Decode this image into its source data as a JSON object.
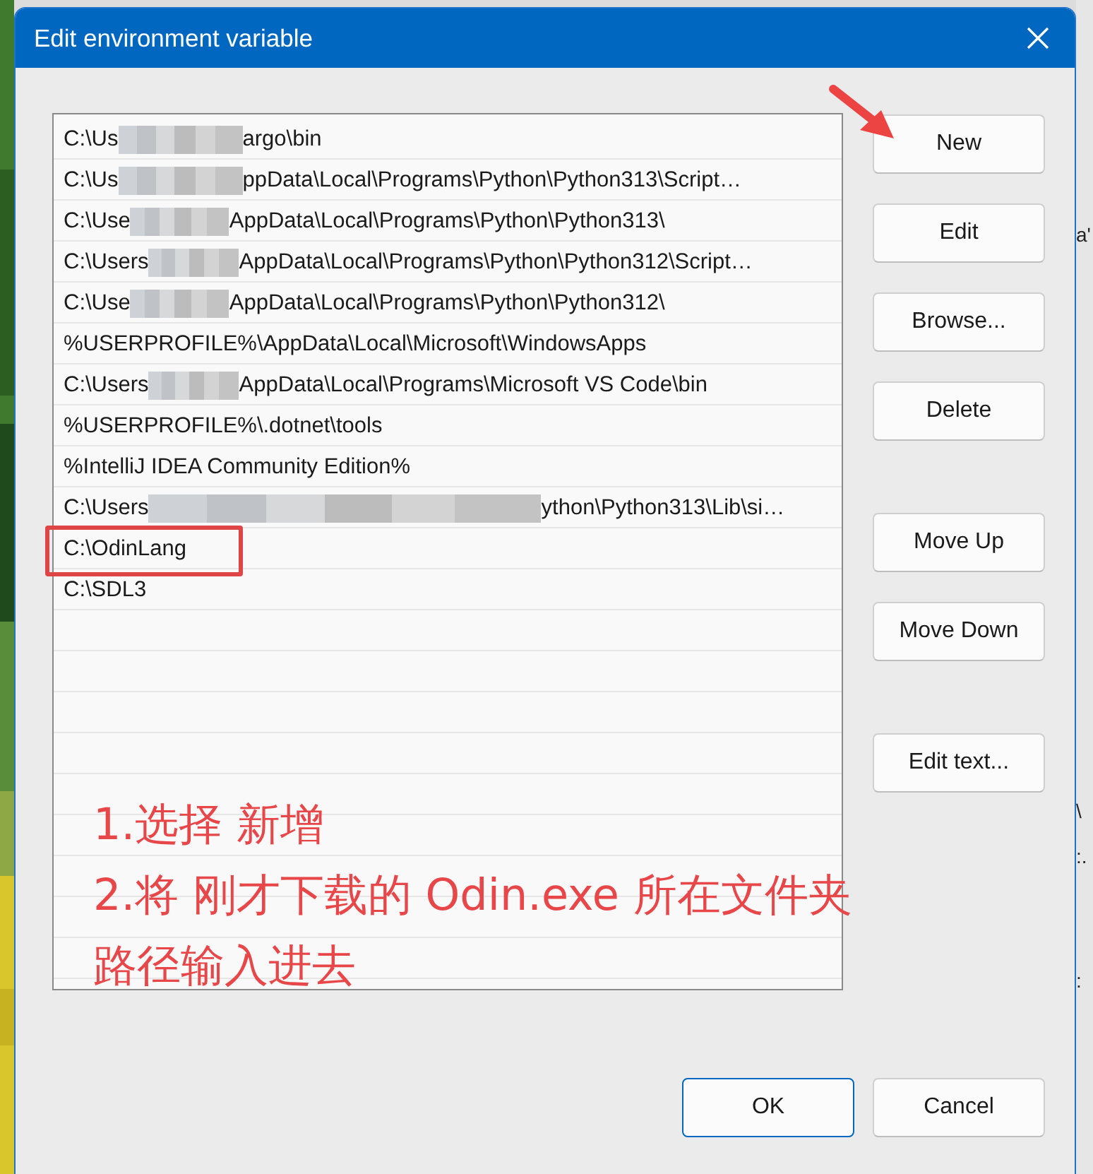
{
  "window": {
    "title": "Edit environment variable"
  },
  "entries": [
    {
      "parts": [
        {
          "kind": "text",
          "text": "C:\\Us"
        },
        {
          "kind": "blur"
        },
        {
          "kind": "text",
          "text": "argo\\bin"
        }
      ],
      "boxed": false
    },
    {
      "parts": [
        {
          "kind": "text",
          "text": "C:\\Us"
        },
        {
          "kind": "blur"
        },
        {
          "kind": "text",
          "text": "ppData\\Local\\Programs\\Python\\Python313\\Script…"
        }
      ],
      "boxed": false
    },
    {
      "parts": [
        {
          "kind": "text",
          "text": "C:\\Use"
        },
        {
          "kind": "blur"
        },
        {
          "kind": "text",
          "text": "AppData\\Local\\Programs\\Python\\Python313\\"
        }
      ],
      "boxed": false
    },
    {
      "parts": [
        {
          "kind": "text",
          "text": "C:\\Users"
        },
        {
          "kind": "blur"
        },
        {
          "kind": "text",
          "text": "AppData\\Local\\Programs\\Python\\Python312\\Script…"
        }
      ],
      "boxed": false
    },
    {
      "parts": [
        {
          "kind": "text",
          "text": "C:\\Use"
        },
        {
          "kind": "blur"
        },
        {
          "kind": "text",
          "text": "AppData\\Local\\Programs\\Python\\Python312\\"
        }
      ],
      "boxed": false
    },
    {
      "parts": [
        {
          "kind": "text",
          "text": "%USERPROFILE%\\AppData\\Local\\Microsoft\\WindowsApps"
        }
      ],
      "boxed": false
    },
    {
      "parts": [
        {
          "kind": "text",
          "text": "C:\\Users"
        },
        {
          "kind": "blur"
        },
        {
          "kind": "text",
          "text": "AppData\\Local\\Programs\\Microsoft VS Code\\bin"
        }
      ],
      "boxed": false
    },
    {
      "parts": [
        {
          "kind": "text",
          "text": "%USERPROFILE%\\.dotnet\\tools"
        }
      ],
      "boxed": false
    },
    {
      "parts": [
        {
          "kind": "text",
          "text": "%IntelliJ IDEA Community Edition%"
        }
      ],
      "boxed": false
    },
    {
      "parts": [
        {
          "kind": "text",
          "text": "C:\\Users"
        },
        {
          "kind": "blur"
        },
        {
          "kind": "text",
          "text": "ython\\Python313\\Lib\\si…"
        }
      ],
      "boxed": false
    },
    {
      "parts": [
        {
          "kind": "text",
          "text": "C:\\OdinLang"
        }
      ],
      "boxed": true
    },
    {
      "parts": [
        {
          "kind": "text",
          "text": "C:\\SDL3"
        }
      ],
      "boxed": false
    }
  ],
  "side_buttons": [
    {
      "label": "New",
      "pointed": true
    },
    {
      "label": "Edit",
      "pointed": false
    },
    {
      "label": "Browse...",
      "pointed": false
    },
    {
      "label": "Delete",
      "pointed": false
    },
    {
      "label": "Move Up",
      "pointed": false
    },
    {
      "label": "Move Down",
      "pointed": false
    },
    {
      "label": "Edit text...",
      "pointed": false
    }
  ],
  "dialog_buttons": [
    {
      "label": "OK",
      "default": true
    },
    {
      "label": "Cancel",
      "default": false
    }
  ],
  "annotation_lines": [
    "1.选择 新增",
    "2.将 刚才下载的 Odin.exe 所在文件夹",
    "路径输入进去"
  ],
  "behind_window": {
    "fragments": [
      "a'",
      "\\",
      ":.",
      ":"
    ]
  }
}
